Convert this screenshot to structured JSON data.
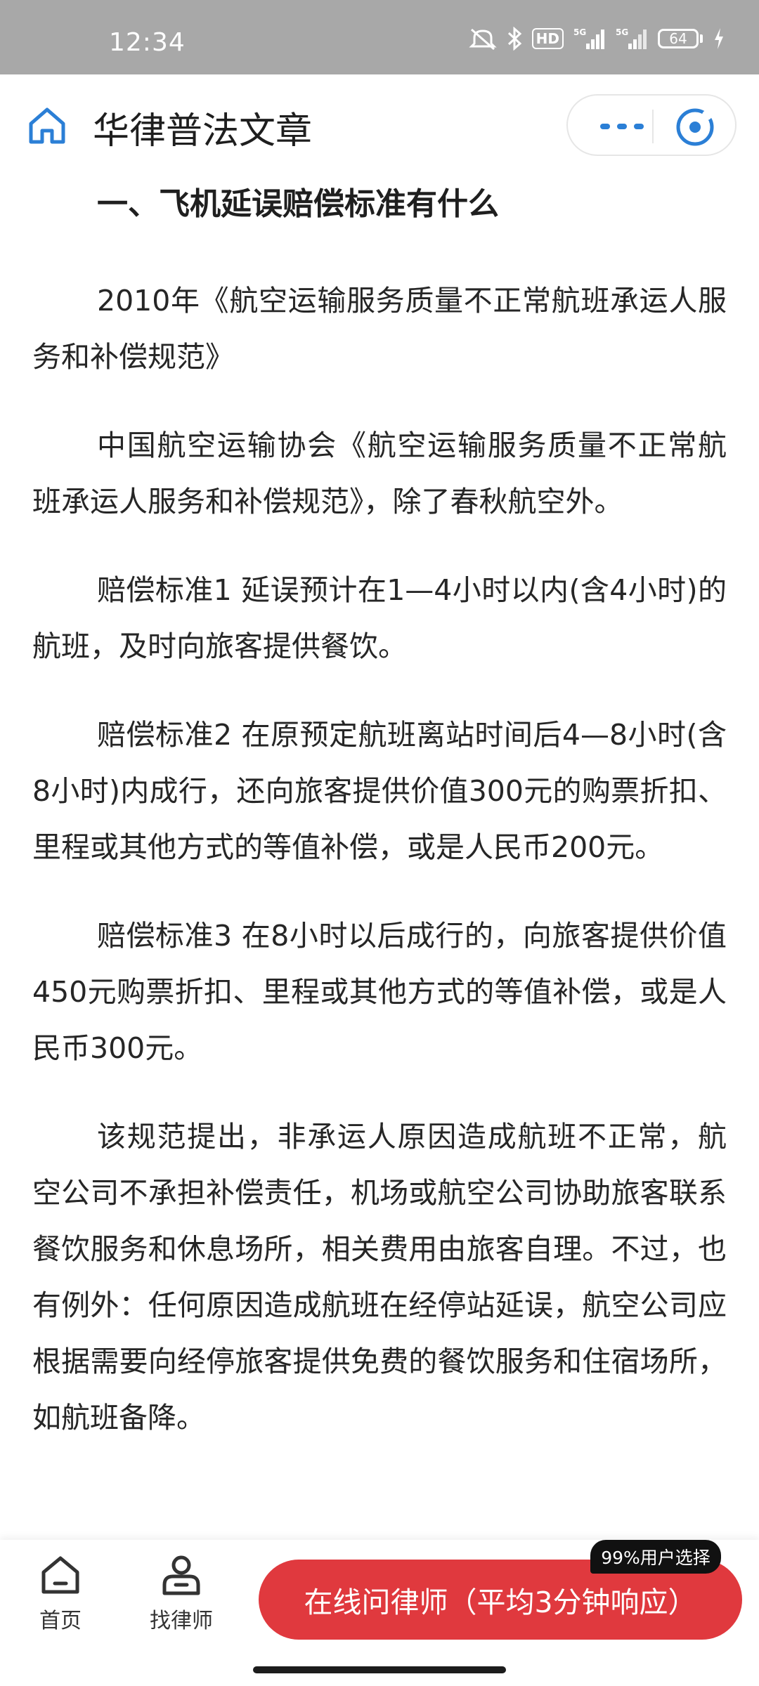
{
  "status_bar": {
    "time": "12:34",
    "battery": "64",
    "icons": [
      "mute-icon",
      "bluetooth-icon",
      "hd-icon",
      "5g-signal-icon",
      "5g-signal-icon",
      "charging-icon"
    ],
    "hd_label": "HD",
    "net1": "5G",
    "net2": "5G"
  },
  "header": {
    "title": "华律普法文章"
  },
  "article": {
    "heading": "一、飞机延误赔偿标准有什么",
    "paragraphs": [
      "2010年《航空运输服务质量不正常航班承运人服务和补偿规范》",
      "中国航空运输协会《航空运输服务质量不正常航班承运人服务和补偿规范》，除了春秋航空外。",
      "赔偿标准1 延误预计在1—4小时以内(含4小时)的航班，及时向旅客提供餐饮。",
      "赔偿标准2 在原预定航班离站时间后4—8小时(含8小时)内成行，还向旅客提供价值300元的购票折扣、里程或其他方式的等值补偿，或是人民币200元。",
      "赔偿标准3 在8小时以后成行的，向旅客提供价值450元购票折扣、里程或其他方式的等值补偿，或是人民币300元。",
      "该规范提出，非承运人原因造成航班不正常，航空公司不承担补偿责任，机场或航空公司协助旅客联系餐饮服务和休息场所，相关费用由旅客自理。不过，也有例外：任何原因造成航班在经停站延误，航空公司应根据需要向经停旅客提供免费的餐饮服务和住宿场所，如航班备降。"
    ]
  },
  "bottom_nav": {
    "home_label": "首页",
    "lawyer_label": "找律师",
    "cta_label": "在线问律师（平均3分钟响应）",
    "badge": "99%用户选择"
  },
  "colors": {
    "accent_blue": "#2b7fd6",
    "cta_red": "#e0393e",
    "status_bar_gray": "#a8a8a8"
  }
}
